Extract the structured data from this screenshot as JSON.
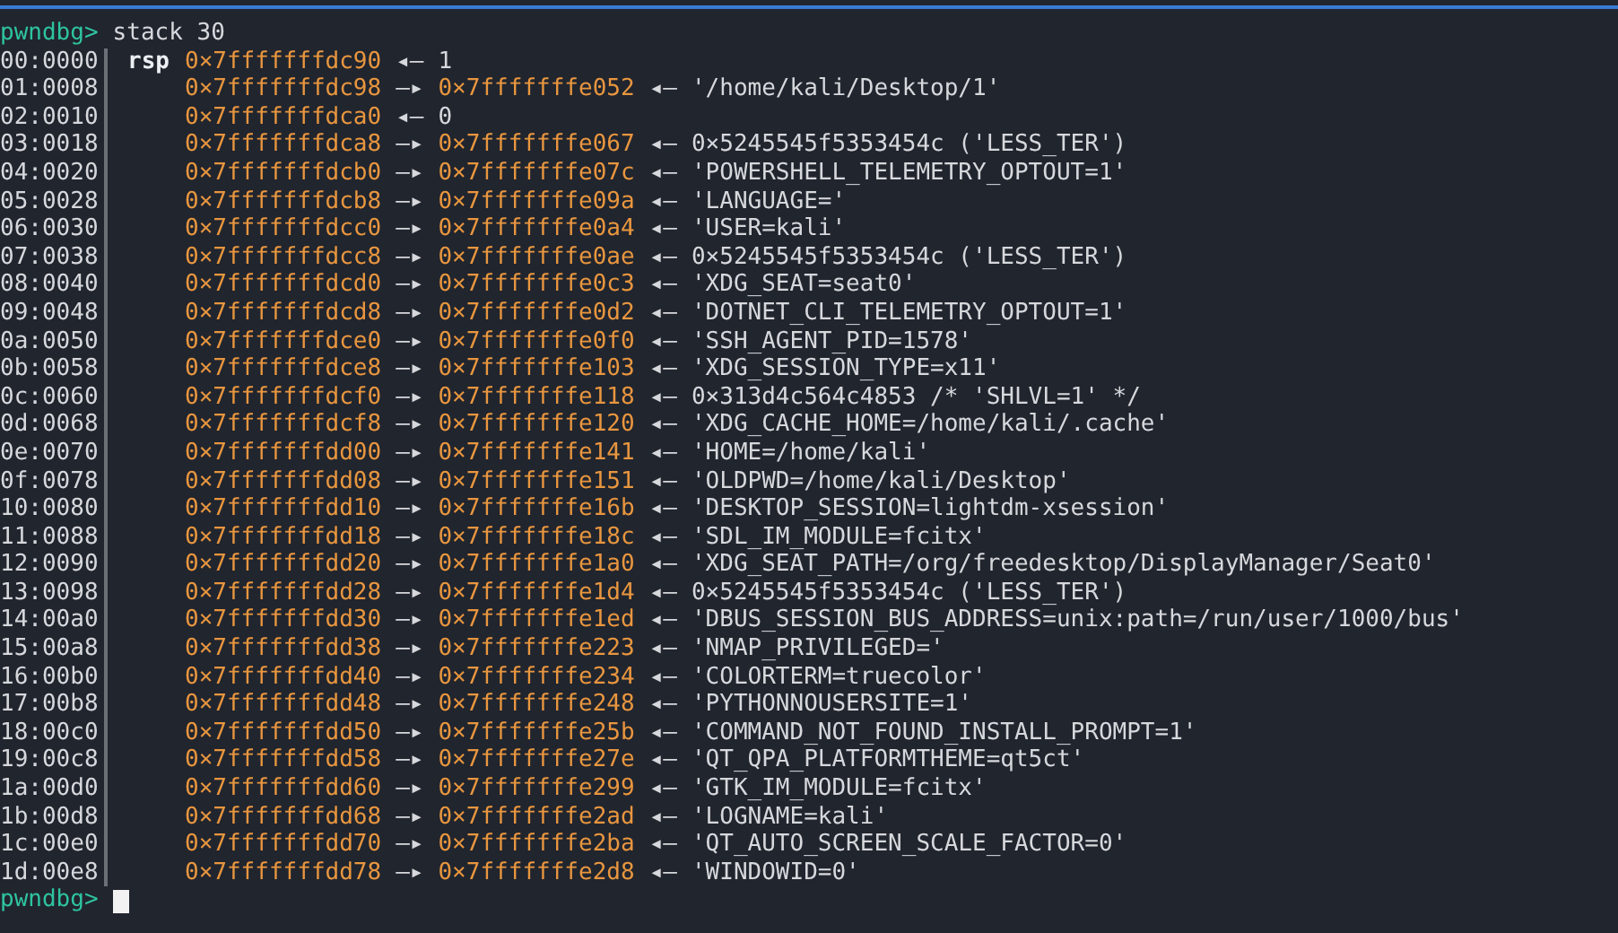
{
  "prompt": "pwndbg>",
  "command": "stack 30",
  "rows": [
    {
      "offset": "00:0000",
      "register": "rsp",
      "address": "0×7fffffffdc90",
      "links": [
        {
          "kind": "value",
          "arrow": "◂—",
          "text": "1"
        }
      ]
    },
    {
      "offset": "01:0008",
      "address": "0×7fffffffdc98",
      "links": [
        {
          "kind": "pointer",
          "arrow": "—▸",
          "text": "0×7fffffffe052"
        },
        {
          "kind": "value",
          "arrow": "◂—",
          "text": "'/home/kali/Desktop/1'"
        }
      ]
    },
    {
      "offset": "02:0010",
      "address": "0×7fffffffdca0",
      "links": [
        {
          "kind": "value",
          "arrow": "◂—",
          "text": "0"
        }
      ]
    },
    {
      "offset": "03:0018",
      "address": "0×7fffffffdca8",
      "links": [
        {
          "kind": "pointer",
          "arrow": "—▸",
          "text": "0×7fffffffe067"
        },
        {
          "kind": "value",
          "arrow": "◂—",
          "text": "0×5245545f5353454c ('LESS_TER')"
        }
      ]
    },
    {
      "offset": "04:0020",
      "address": "0×7fffffffdcb0",
      "links": [
        {
          "kind": "pointer",
          "arrow": "—▸",
          "text": "0×7fffffffe07c"
        },
        {
          "kind": "value",
          "arrow": "◂—",
          "text": "'POWERSHELL_TELEMETRY_OPTOUT=1'"
        }
      ]
    },
    {
      "offset": "05:0028",
      "address": "0×7fffffffdcb8",
      "links": [
        {
          "kind": "pointer",
          "arrow": "—▸",
          "text": "0×7fffffffe09a"
        },
        {
          "kind": "value",
          "arrow": "◂—",
          "text": "'LANGUAGE='"
        }
      ]
    },
    {
      "offset": "06:0030",
      "address": "0×7fffffffdcc0",
      "links": [
        {
          "kind": "pointer",
          "arrow": "—▸",
          "text": "0×7fffffffe0a4"
        },
        {
          "kind": "value",
          "arrow": "◂—",
          "text": "'USER=kali'"
        }
      ]
    },
    {
      "offset": "07:0038",
      "address": "0×7fffffffdcc8",
      "links": [
        {
          "kind": "pointer",
          "arrow": "—▸",
          "text": "0×7fffffffe0ae"
        },
        {
          "kind": "value",
          "arrow": "◂—",
          "text": "0×5245545f5353454c ('LESS_TER')"
        }
      ]
    },
    {
      "offset": "08:0040",
      "address": "0×7fffffffdcd0",
      "links": [
        {
          "kind": "pointer",
          "arrow": "—▸",
          "text": "0×7fffffffe0c3"
        },
        {
          "kind": "value",
          "arrow": "◂—",
          "text": "'XDG_SEAT=seat0'"
        }
      ]
    },
    {
      "offset": "09:0048",
      "address": "0×7fffffffdcd8",
      "links": [
        {
          "kind": "pointer",
          "arrow": "—▸",
          "text": "0×7fffffffe0d2"
        },
        {
          "kind": "value",
          "arrow": "◂—",
          "text": "'DOTNET_CLI_TELEMETRY_OPTOUT=1'"
        }
      ]
    },
    {
      "offset": "0a:0050",
      "address": "0×7fffffffdce0",
      "links": [
        {
          "kind": "pointer",
          "arrow": "—▸",
          "text": "0×7fffffffe0f0"
        },
        {
          "kind": "value",
          "arrow": "◂—",
          "text": "'SSH_AGENT_PID=1578'"
        }
      ]
    },
    {
      "offset": "0b:0058",
      "address": "0×7fffffffdce8",
      "links": [
        {
          "kind": "pointer",
          "arrow": "—▸",
          "text": "0×7fffffffe103"
        },
        {
          "kind": "value",
          "arrow": "◂—",
          "text": "'XDG_SESSION_TYPE=x11'"
        }
      ]
    },
    {
      "offset": "0c:0060",
      "address": "0×7fffffffdcf0",
      "links": [
        {
          "kind": "pointer",
          "arrow": "—▸",
          "text": "0×7fffffffe118"
        },
        {
          "kind": "value",
          "arrow": "◂—",
          "text": "0×313d4c564c4853 /* 'SHLVL=1' */"
        }
      ]
    },
    {
      "offset": "0d:0068",
      "address": "0×7fffffffdcf8",
      "links": [
        {
          "kind": "pointer",
          "arrow": "—▸",
          "text": "0×7fffffffe120"
        },
        {
          "kind": "value",
          "arrow": "◂—",
          "text": "'XDG_CACHE_HOME=/home/kali/.cache'"
        }
      ]
    },
    {
      "offset": "0e:0070",
      "address": "0×7fffffffdd00",
      "links": [
        {
          "kind": "pointer",
          "arrow": "—▸",
          "text": "0×7fffffffe141"
        },
        {
          "kind": "value",
          "arrow": "◂—",
          "text": "'HOME=/home/kali'"
        }
      ]
    },
    {
      "offset": "0f:0078",
      "address": "0×7fffffffdd08",
      "links": [
        {
          "kind": "pointer",
          "arrow": "—▸",
          "text": "0×7fffffffe151"
        },
        {
          "kind": "value",
          "arrow": "◂—",
          "text": "'OLDPWD=/home/kali/Desktop'"
        }
      ]
    },
    {
      "offset": "10:0080",
      "address": "0×7fffffffdd10",
      "links": [
        {
          "kind": "pointer",
          "arrow": "—▸",
          "text": "0×7fffffffe16b"
        },
        {
          "kind": "value",
          "arrow": "◂—",
          "text": "'DESKTOP_SESSION=lightdm-xsession'"
        }
      ]
    },
    {
      "offset": "11:0088",
      "address": "0×7fffffffdd18",
      "links": [
        {
          "kind": "pointer",
          "arrow": "—▸",
          "text": "0×7fffffffe18c"
        },
        {
          "kind": "value",
          "arrow": "◂—",
          "text": "'SDL_IM_MODULE=fcitx'"
        }
      ]
    },
    {
      "offset": "12:0090",
      "address": "0×7fffffffdd20",
      "links": [
        {
          "kind": "pointer",
          "arrow": "—▸",
          "text": "0×7fffffffe1a0"
        },
        {
          "kind": "value",
          "arrow": "◂—",
          "text": "'XDG_SEAT_PATH=/org/freedesktop/DisplayManager/Seat0'"
        }
      ]
    },
    {
      "offset": "13:0098",
      "address": "0×7fffffffdd28",
      "links": [
        {
          "kind": "pointer",
          "arrow": "—▸",
          "text": "0×7fffffffe1d4"
        },
        {
          "kind": "value",
          "arrow": "◂—",
          "text": "0×5245545f5353454c ('LESS_TER')"
        }
      ]
    },
    {
      "offset": "14:00a0",
      "address": "0×7fffffffdd30",
      "links": [
        {
          "kind": "pointer",
          "arrow": "—▸",
          "text": "0×7fffffffe1ed"
        },
        {
          "kind": "value",
          "arrow": "◂—",
          "text": "'DBUS_SESSION_BUS_ADDRESS=unix:path=/run/user/1000/bus'"
        }
      ]
    },
    {
      "offset": "15:00a8",
      "address": "0×7fffffffdd38",
      "links": [
        {
          "kind": "pointer",
          "arrow": "—▸",
          "text": "0×7fffffffe223"
        },
        {
          "kind": "value",
          "arrow": "◂—",
          "text": "'NMAP_PRIVILEGED='"
        }
      ]
    },
    {
      "offset": "16:00b0",
      "address": "0×7fffffffdd40",
      "links": [
        {
          "kind": "pointer",
          "arrow": "—▸",
          "text": "0×7fffffffe234"
        },
        {
          "kind": "value",
          "arrow": "◂—",
          "text": "'COLORTERM=truecolor'"
        }
      ]
    },
    {
      "offset": "17:00b8",
      "address": "0×7fffffffdd48",
      "links": [
        {
          "kind": "pointer",
          "arrow": "—▸",
          "text": "0×7fffffffe248"
        },
        {
          "kind": "value",
          "arrow": "◂—",
          "text": "'PYTHONNOUSERSITE=1'"
        }
      ]
    },
    {
      "offset": "18:00c0",
      "address": "0×7fffffffdd50",
      "links": [
        {
          "kind": "pointer",
          "arrow": "—▸",
          "text": "0×7fffffffe25b"
        },
        {
          "kind": "value",
          "arrow": "◂—",
          "text": "'COMMAND_NOT_FOUND_INSTALL_PROMPT=1'"
        }
      ]
    },
    {
      "offset": "19:00c8",
      "address": "0×7fffffffdd58",
      "links": [
        {
          "kind": "pointer",
          "arrow": "—▸",
          "text": "0×7fffffffe27e"
        },
        {
          "kind": "value",
          "arrow": "◂—",
          "text": "'QT_QPA_PLATFORMTHEME=qt5ct'"
        }
      ]
    },
    {
      "offset": "1a:00d0",
      "address": "0×7fffffffdd60",
      "links": [
        {
          "kind": "pointer",
          "arrow": "—▸",
          "text": "0×7fffffffe299"
        },
        {
          "kind": "value",
          "arrow": "◂—",
          "text": "'GTK_IM_MODULE=fcitx'"
        }
      ]
    },
    {
      "offset": "1b:00d8",
      "address": "0×7fffffffdd68",
      "links": [
        {
          "kind": "pointer",
          "arrow": "—▸",
          "text": "0×7fffffffe2ad"
        },
        {
          "kind": "value",
          "arrow": "◂—",
          "text": "'LOGNAME=kali'"
        }
      ]
    },
    {
      "offset": "1c:00e0",
      "address": "0×7fffffffdd70",
      "links": [
        {
          "kind": "pointer",
          "arrow": "—▸",
          "text": "0×7fffffffe2ba"
        },
        {
          "kind": "value",
          "arrow": "◂—",
          "text": "'QT_AUTO_SCREEN_SCALE_FACTOR=0'"
        }
      ]
    },
    {
      "offset": "1d:00e8",
      "address": "0×7fffffffdd78",
      "links": [
        {
          "kind": "pointer",
          "arrow": "—▸",
          "text": "0×7fffffffe2d8"
        },
        {
          "kind": "value",
          "arrow": "◂—",
          "text": "'WINDOWID=0'"
        }
      ]
    }
  ],
  "final_prompt": "pwndbg>"
}
